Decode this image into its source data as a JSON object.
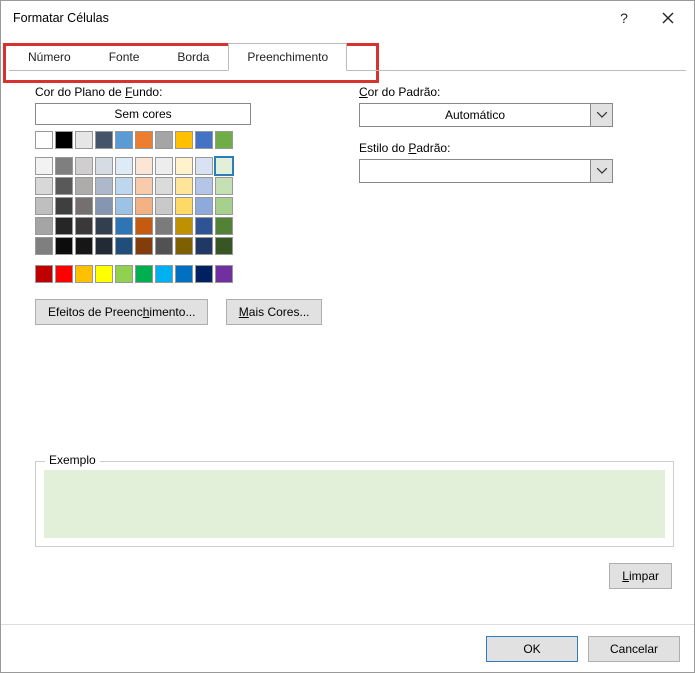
{
  "title": "Formatar Células",
  "tabs": {
    "t0": "Número",
    "t1": "Fonte",
    "t2": "Borda",
    "t3": "Preenchimento",
    "activeIndex": 3
  },
  "left": {
    "bg_label_pre": "Cor do Plano de ",
    "bg_label_u": "F",
    "bg_label_post": "undo:",
    "no_color": "Sem cores",
    "fill_effects_pre": "Efeitos de Preenc",
    "fill_effects_u": "h",
    "fill_effects_post": "imento...",
    "more_colors_u": "M",
    "more_colors_post": "ais Cores..."
  },
  "right": {
    "pattern_color_u": "C",
    "pattern_color_post": "or do Padrão:",
    "auto": "Automático",
    "pattern_style_pre": "Estilo do ",
    "pattern_style_u": "P",
    "pattern_style_post": "adrão:"
  },
  "sample_label": "Exemplo",
  "clear_u": "L",
  "clear_post": "impar",
  "ok": "OK",
  "cancel": "Cancelar",
  "selected_color": "#e0eed7",
  "theme_colors": [
    "#ffffff",
    "#000000",
    "#e7e6e6",
    "#44546a",
    "#5b9bd5",
    "#ed7d31",
    "#a5a5a5",
    "#ffc000",
    "#4472c4",
    "#70ad47"
  ],
  "variant_colors": [
    "#f2f2f2",
    "#7f7f7f",
    "#d0cece",
    "#d6dce4",
    "#deebf6",
    "#fbe5d5",
    "#ededed",
    "#fff2cc",
    "#d9e2f3",
    "#e2efd9",
    "#d8d8d8",
    "#595959",
    "#aeabab",
    "#adb9ca",
    "#bdd7ee",
    "#f7cbac",
    "#dbdbdb",
    "#fee599",
    "#b4c6e7",
    "#c5e0b3",
    "#bfbfbf",
    "#3f3f3f",
    "#757070",
    "#8496b0",
    "#9cc3e5",
    "#f4b183",
    "#c9c9c9",
    "#ffd965",
    "#8eaadb",
    "#a8d08d",
    "#a5a5a5",
    "#262626",
    "#3a3838",
    "#323f4f",
    "#2e75b5",
    "#c55a11",
    "#7b7b7b",
    "#bf9000",
    "#2f5496",
    "#538135",
    "#7f7f7f",
    "#0c0c0c",
    "#171616",
    "#222a35",
    "#1e4e79",
    "#833c0b",
    "#525252",
    "#7f6000",
    "#1f3864",
    "#375623"
  ],
  "standard_colors": [
    "#c00000",
    "#ff0000",
    "#ffc000",
    "#ffff00",
    "#92d050",
    "#00b050",
    "#00b0f0",
    "#0070c0",
    "#002060",
    "#7030a0"
  ]
}
